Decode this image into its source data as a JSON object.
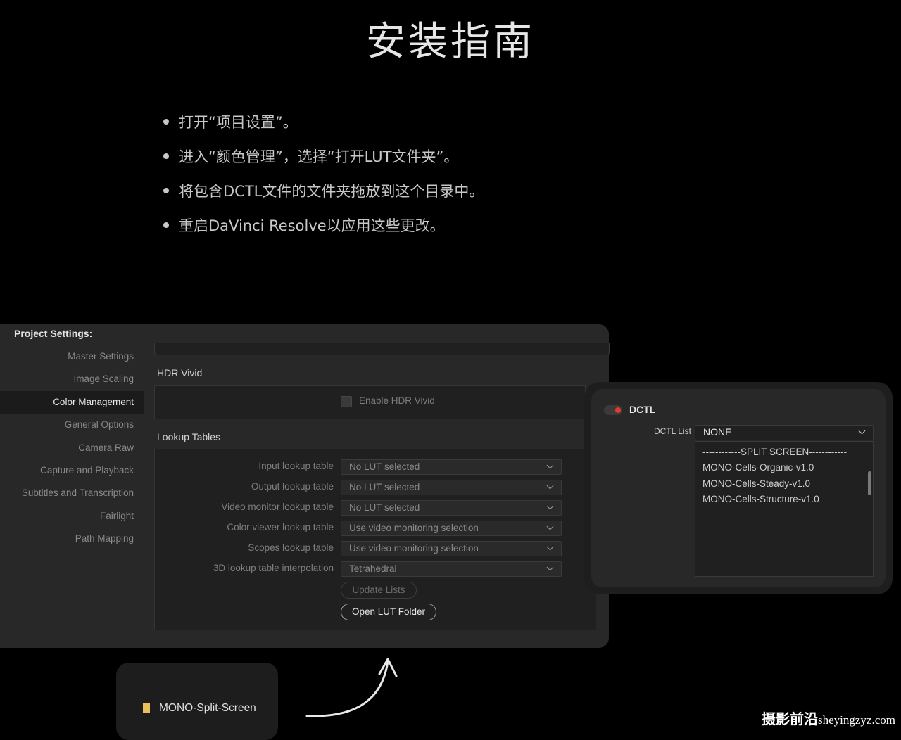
{
  "heading": "安装指南",
  "steps": [
    "打开“项目设置”。",
    "进入“颜色管理”，选择“打开LUT文件夹”。",
    "将包含DCTL文件的文件夹拖放到这个目录中。",
    "重启DaVinci Resolve以应用这些更改。"
  ],
  "project_settings": {
    "title": "Project Settings:",
    "nav": [
      {
        "label": "Master Settings",
        "active": false
      },
      {
        "label": "Image Scaling",
        "active": false
      },
      {
        "label": "Color Management",
        "active": true
      },
      {
        "label": "General Options",
        "active": false
      },
      {
        "label": "Camera Raw",
        "active": false
      },
      {
        "label": "Capture and Playback",
        "active": false
      },
      {
        "label": "Subtitles and Transcription",
        "active": false
      },
      {
        "label": "Fairlight",
        "active": false
      },
      {
        "label": "Path Mapping",
        "active": false
      }
    ],
    "hdr_section": "HDR Vivid",
    "hdr_checkbox_label": "Enable HDR Vivid",
    "lookup_section": "Lookup Tables",
    "lookup_rows": [
      {
        "label": "Input lookup table",
        "value": "No LUT selected"
      },
      {
        "label": "Output lookup table",
        "value": "No LUT selected"
      },
      {
        "label": "Video monitor lookup table",
        "value": "No LUT selected"
      },
      {
        "label": "Color viewer lookup table",
        "value": "Use video monitoring selection"
      },
      {
        "label": "Scopes lookup table",
        "value": "Use video monitoring selection"
      },
      {
        "label": "3D lookup table interpolation",
        "value": "Tetrahedral"
      }
    ],
    "update_button": "Update Lists",
    "open_folder_button": "Open LUT Folder"
  },
  "dctl": {
    "title": "DCTL",
    "list_label": "DCTL List",
    "selected": "NONE",
    "options": [
      "------------SPLIT SCREEN------------",
      "MONO-Cells-Organic-v1.0",
      "MONO-Cells-Steady-v1.0",
      "MONO-Cells-Structure-v1.0"
    ],
    "toggle_color": "#e53b2b"
  },
  "folder": {
    "name": "MONO-Split-Screen",
    "icon": "folder-icon"
  },
  "watermark": {
    "cn": "摄影前沿",
    "site": "sheyingzyz.com"
  }
}
